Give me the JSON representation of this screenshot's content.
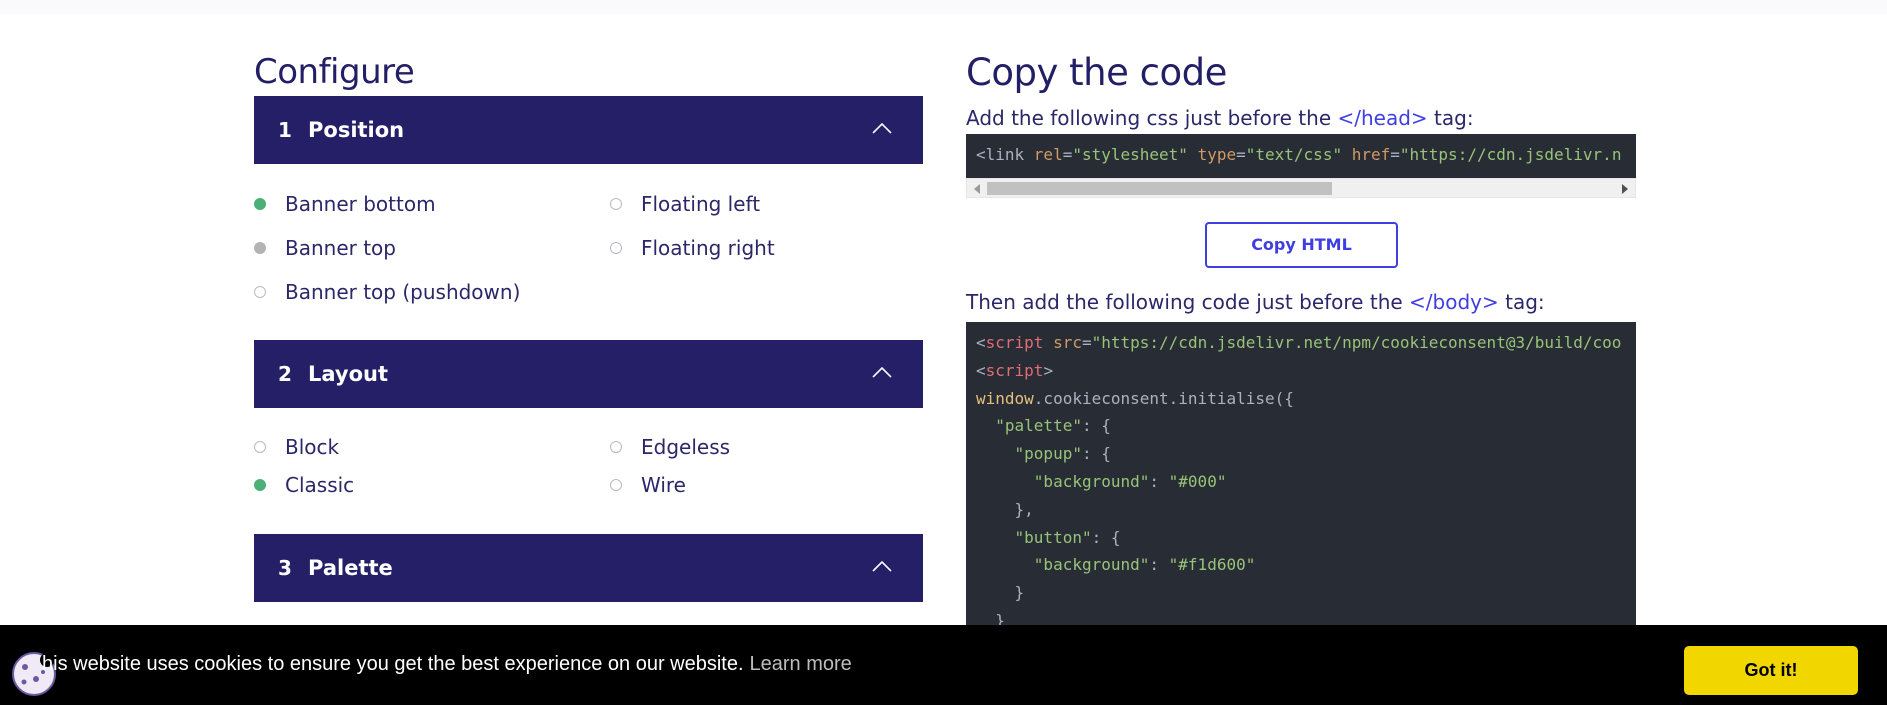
{
  "configure": {
    "title": "Configure",
    "panels": [
      {
        "num": "1",
        "title": "Position",
        "options": [
          {
            "label": "Banner bottom",
            "state": "selected"
          },
          {
            "label": "Floating left",
            "state": "off"
          },
          {
            "label": "Banner top",
            "state": "hover"
          },
          {
            "label": "Floating right",
            "state": "off"
          },
          {
            "label": "Banner top (pushdown)",
            "state": "off"
          }
        ]
      },
      {
        "num": "2",
        "title": "Layout",
        "options": [
          {
            "label": "Block",
            "state": "off"
          },
          {
            "label": "Edgeless",
            "state": "off"
          },
          {
            "label": "Classic",
            "state": "selected"
          },
          {
            "label": "Wire",
            "state": "off"
          }
        ]
      },
      {
        "num": "3",
        "title": "Palette",
        "options": []
      }
    ]
  },
  "copy": {
    "title": "Copy the code",
    "css_intro_before": "Add the following css just before the ",
    "css_intro_tag": "</head>",
    "css_intro_after": " tag:",
    "css_code": {
      "p1": "<link ",
      "a1": "rel",
      "p2": "=",
      "s1": "\"stylesheet\"",
      "a2": " type",
      "p3": "=",
      "s2": "\"text/css\"",
      "a3": " href",
      "p4": "=",
      "s3": "\"https://cdn.jsdelivr.n"
    },
    "copy_button": "Copy HTML",
    "js_intro_before": "Then add the following code just before the ",
    "js_intro_tag": "</body>",
    "js_intro_after": " tag:",
    "js_code": {
      "l1_p": "<",
      "l1_tag": "script",
      "l1_attr": " src",
      "l1_eq": "=",
      "l1_str": "\"https://cdn.jsdelivr.net/npm/cookieconsent@3/build/coo",
      "l2_p1": "<",
      "l2_tag": "script",
      "l2_p2": ">",
      "l3_obj": "window",
      "l3_rest": ".cookieconsent.initialise({",
      "l4_key": "  \"palette\"",
      "l4_rest": ": {",
      "l5_key": "    \"popup\"",
      "l5_rest": ": {",
      "l6_key": "      \"background\"",
      "l6_colon": ": ",
      "l6_val": "\"#000\"",
      "l7": "    },",
      "l8_key": "    \"button\"",
      "l8_rest": ": {",
      "l9_key": "      \"background\"",
      "l9_colon": ": ",
      "l9_val": "\"#f1d600\"",
      "l10": "    }",
      "l11": "  }"
    }
  },
  "cookie_banner": {
    "message": "his website uses cookies to ensure you get the best experience on our website.",
    "learn_more": "Learn more",
    "button": "Got it!"
  },
  "colors": {
    "panel_header": "#251f68",
    "accent": "#3f3ee0",
    "selected_radio": "#4caf78",
    "code_bg": "#282c34",
    "cookie_button": "#f1d600"
  },
  "icons": [
    "chevron-up-icon",
    "cookie-icon",
    "scroll-left-arrow-icon",
    "scroll-right-arrow-icon"
  ]
}
